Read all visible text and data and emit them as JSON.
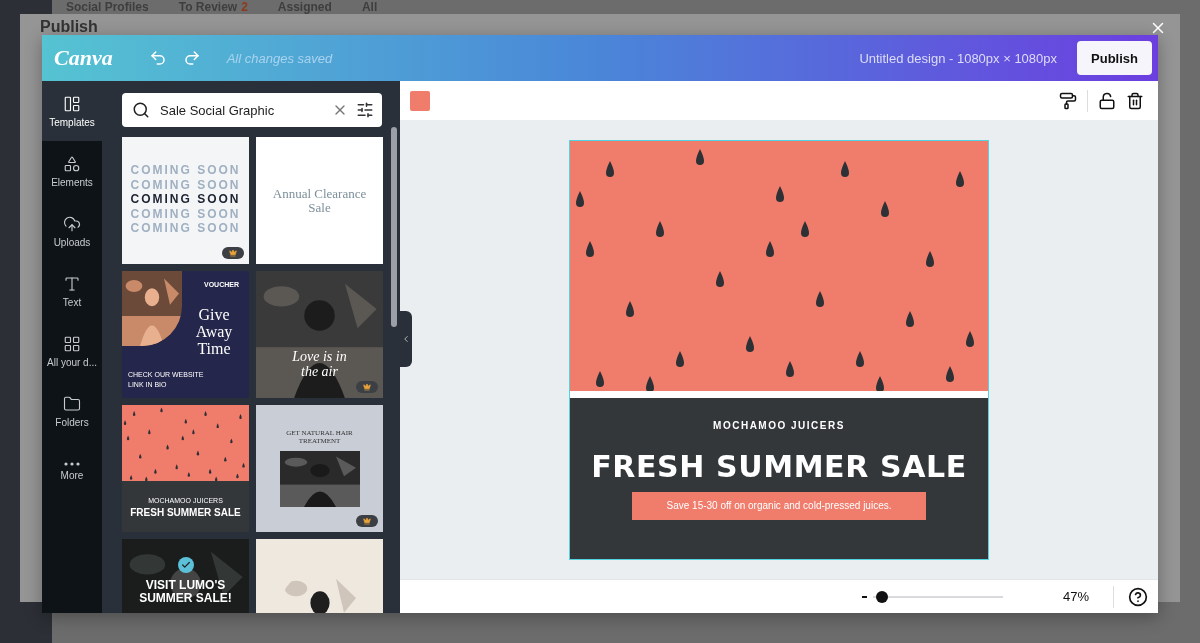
{
  "background_app": {
    "section_title": "Social Profiles",
    "filters": [
      {
        "label": "To Review",
        "count": "2"
      },
      {
        "label": "Assigned"
      },
      {
        "label": "All"
      }
    ]
  },
  "dialog": {
    "title": "Publish"
  },
  "editor": {
    "logo": "Canva",
    "save_status": "All changes saved",
    "design_title": "Untitled design - 1080px × 1080px",
    "publish_button": "Publish",
    "sidebar": [
      {
        "label": "Templates",
        "selected": true
      },
      {
        "label": "Elements",
        "selected": false
      },
      {
        "label": "Uploads",
        "selected": false
      },
      {
        "label": "Text",
        "selected": false
      },
      {
        "label": "All your d...",
        "selected": false
      },
      {
        "label": "Folders",
        "selected": false
      },
      {
        "label": "More",
        "selected": false
      }
    ],
    "search": {
      "value": "Sale Social Graphic"
    },
    "templates": [
      {
        "kind": "text-lines",
        "lines": [
          {
            "text": "COMING SOON",
            "bold": false
          },
          {
            "text": "COMING SOON",
            "bold": false
          },
          {
            "text": "COMING SOON",
            "bold": true
          },
          {
            "text": "COMING SOON",
            "bold": false
          },
          {
            "text": "COMING SOON",
            "bold": false
          }
        ],
        "premium": true
      },
      {
        "kind": "announcement",
        "title": "Annual Clearance Sale",
        "premium": false
      },
      {
        "kind": "voucher",
        "tag": "VOUCHER",
        "title": "Give Away Time",
        "footer": "CHECK OUR WEBSITE",
        "subfooter": "LINK IN BIO",
        "premium": false
      },
      {
        "kind": "photo-quote",
        "title": "Love is in the air",
        "premium": true
      },
      {
        "kind": "watermelon",
        "brand": "MOCHAMOO JUICERS",
        "title": "FRESH SUMMER SALE",
        "premium": false
      },
      {
        "kind": "photo-card",
        "title": "GET NATURAL HAIR TREATMENT",
        "premium": true
      },
      {
        "kind": "dark-promo",
        "title": "VISIT LUMO'S SUMMER SALE!",
        "premium": false
      },
      {
        "kind": "portrait",
        "premium": false
      }
    ],
    "design": {
      "brand": "MOCHAMOO JUICERS",
      "headline": "FRESH SUMMER SALE",
      "offer": "Save 15-30 off on organic and cold-pressed juices."
    },
    "zoom": {
      "level": 0.07,
      "reading": "47%"
    }
  }
}
